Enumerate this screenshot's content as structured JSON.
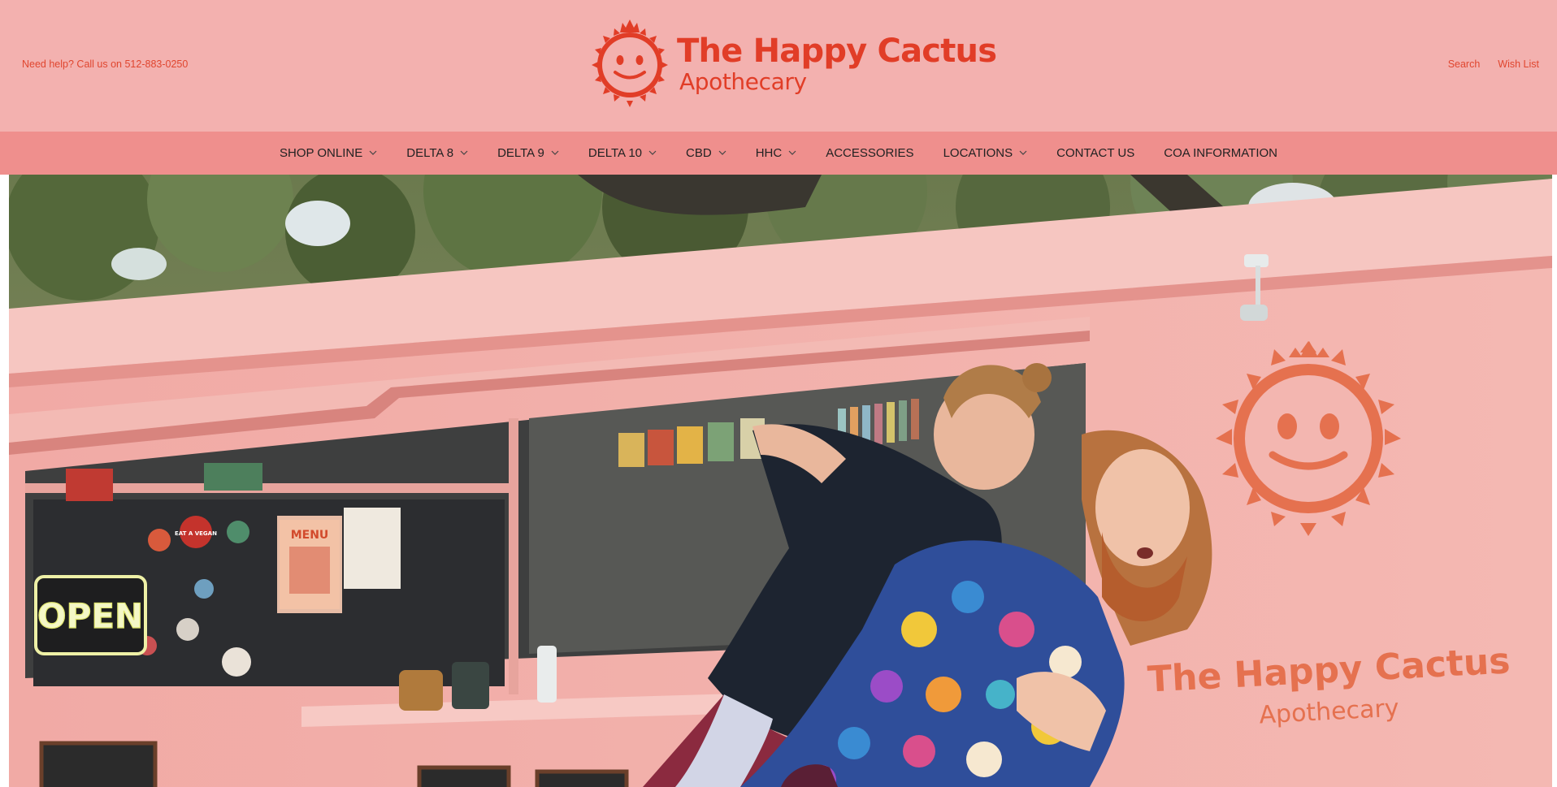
{
  "header": {
    "helpline": "Need help? Call us on 512-883-0250",
    "brand_name": "The Happy Cactus",
    "brand_sub": "Apothecary",
    "links": [
      {
        "label": "Search"
      },
      {
        "label": "Wish List"
      }
    ]
  },
  "nav": {
    "items": [
      {
        "label": "SHOP ONLINE",
        "dropdown": true
      },
      {
        "label": "DELTA 8",
        "dropdown": true
      },
      {
        "label": "DELTA 9",
        "dropdown": true
      },
      {
        "label": "DELTA 10",
        "dropdown": true
      },
      {
        "label": "CBD",
        "dropdown": true
      },
      {
        "label": "HHC",
        "dropdown": true
      },
      {
        "label": "ACCESSORIES",
        "dropdown": false
      },
      {
        "label": "LOCATIONS",
        "dropdown": true
      },
      {
        "label": "CONTACT US",
        "dropdown": false
      },
      {
        "label": "COA INFORMATION",
        "dropdown": false
      }
    ]
  },
  "hero": {
    "sign_open": "OPEN",
    "sign_menu": "MENU",
    "sticker_text": "EAT A VEGAN",
    "wall_brand_name": "The Happy Cactus",
    "wall_brand_sub": "Apothecary"
  },
  "colors": {
    "header_bg": "#f3b1af",
    "nav_bg": "#ef8f8d",
    "brand_red": "#e13d27",
    "wall_orange": "#e5714f"
  }
}
